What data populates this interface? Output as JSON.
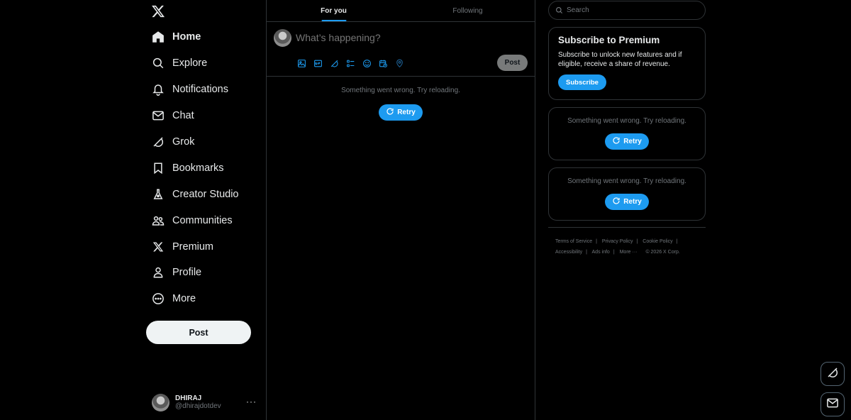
{
  "sidebar": {
    "items": [
      {
        "label": "Home",
        "icon": "home-icon",
        "active": true
      },
      {
        "label": "Explore",
        "icon": "search-icon"
      },
      {
        "label": "Notifications",
        "icon": "bell-icon"
      },
      {
        "label": "Chat",
        "icon": "envelope-icon"
      },
      {
        "label": "Grok",
        "icon": "grok-icon"
      },
      {
        "label": "Bookmarks",
        "icon": "bookmark-icon"
      },
      {
        "label": "Creator Studio",
        "icon": "flask-icon"
      },
      {
        "label": "Communities",
        "icon": "people-icon"
      },
      {
        "label": "Premium",
        "icon": "x-logo-icon"
      },
      {
        "label": "Profile",
        "icon": "person-icon"
      },
      {
        "label": "More",
        "icon": "more-circle-icon"
      }
    ],
    "post_label": "Post",
    "account": {
      "name": "DHIRAJ",
      "handle": "@dhirajdotdev",
      "more": "···"
    }
  },
  "main": {
    "tabs": [
      {
        "label": "For you",
        "active": true
      },
      {
        "label": "Following",
        "active": false
      }
    ],
    "composer": {
      "placeholder": "What’s happening?",
      "post_label": "Post",
      "tools": [
        "image-icon",
        "gif-icon",
        "grok-icon",
        "poll-icon",
        "emoji-icon",
        "schedule-icon",
        "location-icon"
      ]
    },
    "feed_error": {
      "message": "Something went wrong. Try reloading.",
      "retry_label": "Retry"
    }
  },
  "right": {
    "search": {
      "placeholder": "Search"
    },
    "premium": {
      "title": "Subscribe to Premium",
      "body": "Subscribe to unlock new features and if eligible, receive a share of revenue.",
      "button": "Subscribe"
    },
    "error_cards": [
      {
        "message": "Something went wrong. Try reloading.",
        "retry_label": "Retry"
      },
      {
        "message": "Something went wrong. Try reloading.",
        "retry_label": "Retry"
      }
    ],
    "footer": {
      "links": [
        "Terms of Service",
        "Privacy Policy",
        "Cookie Policy",
        "Accessibility",
        "Ads info",
        "More ···"
      ],
      "copyright": "© 2026 X Corp."
    }
  },
  "colors": {
    "accent": "#1d9bf0",
    "background": "#000000",
    "border": "#2f3336",
    "muted": "#71767b",
    "text": "#e7e9ea"
  }
}
